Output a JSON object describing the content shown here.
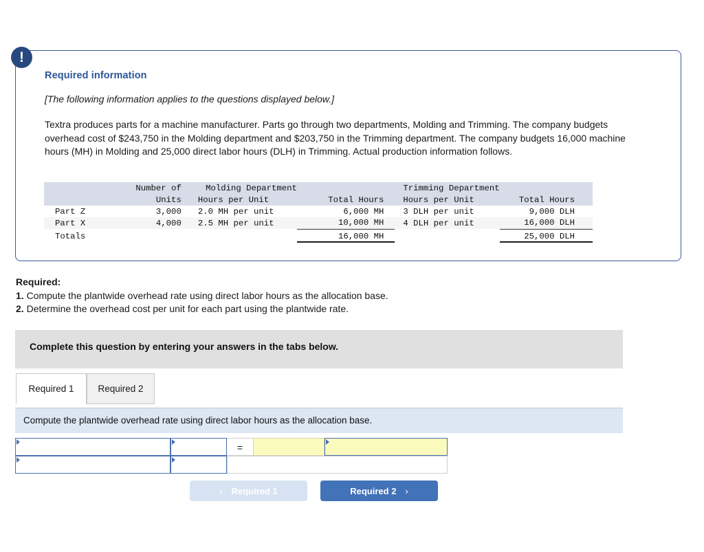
{
  "alert": {
    "icon": "exclamation-icon",
    "glyph": "!"
  },
  "card": {
    "title": "Required information",
    "italic_note": "[The following information applies to the questions displayed below.]",
    "body": "Textra produces parts for a machine manufacturer. Parts go through two departments, Molding and Trimming. The company budgets overhead cost of $243,750 in the Molding department and $203,750 in the Trimming department. The company budgets 16,000 machine hours (MH) in Molding and 25,000 direct labor hours (DLH) in Trimming. Actual production information follows."
  },
  "table": {
    "group_headers": {
      "blank": "",
      "number_of": "Number of",
      "molding": "Molding Department",
      "trimming": "Trimming Department"
    },
    "sub_headers": {
      "blank": "",
      "units": "Units",
      "molding_hpu": "Hours per Unit",
      "molding_total": "Total Hours",
      "trimming_hpu": "Hours per Unit",
      "trimming_total": "Total Hours"
    },
    "rows": [
      {
        "label": "Part Z",
        "units": "3,000",
        "molding_hpu": "2.0 MH per unit",
        "molding_total": "6,000 MH",
        "trimming_hpu": "3 DLH per unit",
        "trimming_total": "9,000 DLH"
      },
      {
        "label": "Part X",
        "units": "4,000",
        "molding_hpu": "2.5 MH per unit",
        "molding_total": "10,000 MH",
        "trimming_hpu": "4 DLH per unit",
        "trimming_total": "16,000 DLH"
      }
    ],
    "totals": {
      "label": "Totals",
      "units": "",
      "molding_hpu": "",
      "molding_total": "16,000 MH",
      "trimming_hpu": "",
      "trimming_total": "25,000 DLH"
    }
  },
  "required": {
    "heading": "Required:",
    "item1_num": "1.",
    "item1_text": "Compute the plantwide overhead rate using direct labor hours as the allocation base.",
    "item2_num": "2.",
    "item2_text": "Determine the overhead cost per unit for each part using the plantwide rate."
  },
  "instruction_bar": {
    "text": "Complete this question by entering your answers in the tabs below."
  },
  "tabs": [
    {
      "label": "Required 1",
      "active": true
    },
    {
      "label": "Required 2",
      "active": false
    }
  ],
  "prompt_bar": {
    "text": "Compute the plantwide overhead rate using direct labor hours as the allocation base."
  },
  "answer_grid": {
    "r1c1": "",
    "r1c2": "",
    "operator": "=",
    "r1c3": "",
    "r1c4": "",
    "r2c1": "",
    "r2c2": "",
    "r2c3": ""
  },
  "nav": {
    "prev_label": "Required 1",
    "prev_chevron": "‹",
    "next_label": "Required 2",
    "next_chevron": "›"
  },
  "colors": {
    "card_border": "#3a5a97",
    "badge": "#27487f",
    "title": "#2c5699",
    "table_header_bg": "#d7dce8",
    "gray_bar": "#e0e0e0",
    "blue_bar": "#dce7f3",
    "cell_border_blue": "#4a71b0",
    "cell_yellow": "#fbfbbe",
    "btn_active": "#4272b8",
    "btn_disabled": "#d7e3f2"
  }
}
